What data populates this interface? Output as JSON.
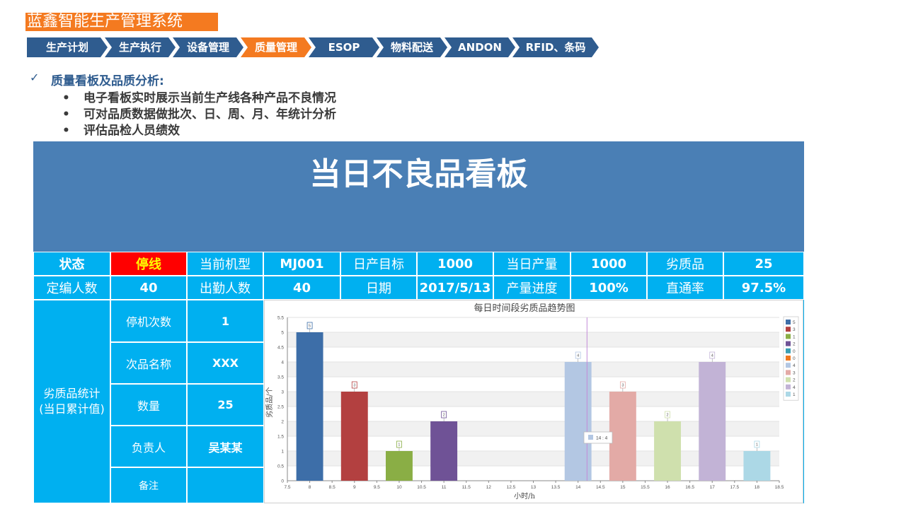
{
  "header": {
    "title": "蓝鑫智能生产管理系统"
  },
  "nav": {
    "items": [
      {
        "label": "生产计划"
      },
      {
        "label": "生产执行"
      },
      {
        "label": "设备管理"
      },
      {
        "label": "质量管理"
      },
      {
        "label": "ESOP"
      },
      {
        "label": "物料配送"
      },
      {
        "label": "ANDON"
      },
      {
        "label": "RFID、条码"
      }
    ],
    "active": "质量管理"
  },
  "section": {
    "check_mark": "✓",
    "heading": "质量看板及品质分析:",
    "bullet": "•",
    "bullets": [
      "电子看板实时展示当前生产线各种产品不良情况",
      "可对品质数据做批次、日、周、月、年统计分析",
      "评估品检人员绩效"
    ]
  },
  "board": {
    "title": "当日不良品看板",
    "row1": {
      "status_label": "状态",
      "status_value": "停线",
      "model_label": "当前机型",
      "model_value": "MJ001",
      "target_label": "日产目标",
      "target_value": "1000",
      "output_label": "当日产量",
      "output_value": "1000",
      "defect_label": "劣质品",
      "defect_value": "25"
    },
    "row2": {
      "staff_label": "定编人数",
      "staff_value": "40",
      "attend_label": "出勤人数",
      "attend_value": "40",
      "date_label": "日期",
      "date_value": "2017/5/13",
      "progress_label": "产量进度",
      "progress_value": "100%",
      "pass_label": "直通率",
      "pass_value": "97.5%"
    },
    "stats": {
      "label_line1": "劣质品统计",
      "label_line2": "(当日累计值)",
      "rows": [
        {
          "label": "停机次数",
          "value": "1"
        },
        {
          "label": "次品名称",
          "value": "XXX"
        },
        {
          "label": "数量",
          "value": "25"
        },
        {
          "label": "负责人",
          "value": "吴某某"
        },
        {
          "label": "备注",
          "value": ""
        }
      ]
    }
  },
  "chart_data": {
    "type": "bar",
    "title": "每日时间段劣质品趋势图",
    "xlabel": "小时/h",
    "ylabel": "劣质品/个",
    "xlim": [
      7.5,
      18.5
    ],
    "ylim": [
      0,
      5.5
    ],
    "x_ticks": [
      7.5,
      8,
      8.5,
      9,
      9.5,
      10,
      10.5,
      11,
      11.5,
      12,
      12.5,
      13,
      13.5,
      14,
      14.5,
      15,
      15.5,
      16,
      16.5,
      17,
      17.5,
      18,
      18.5
    ],
    "y_ticks": [
      0,
      0.5,
      1,
      1.5,
      2,
      2.5,
      3,
      3.5,
      4,
      4.5,
      5,
      5.5
    ],
    "bars": [
      {
        "x": 8,
        "value": 5,
        "color": "#3d6ea8"
      },
      {
        "x": 9,
        "value": 3,
        "color": "#b34040"
      },
      {
        "x": 10,
        "value": 1,
        "color": "#8aae45"
      },
      {
        "x": 11,
        "value": 2,
        "color": "#6f5296"
      },
      {
        "x": 14,
        "value": 4,
        "color": "#b3c7e3"
      },
      {
        "x": 15,
        "value": 3,
        "color": "#e3aaa6"
      },
      {
        "x": 16,
        "value": 2,
        "color": "#cfe0ad"
      },
      {
        "x": 17,
        "value": 4,
        "color": "#c2b3d6"
      },
      {
        "x": 18,
        "value": 1,
        "color": "#acd8e6"
      }
    ],
    "legend": [
      {
        "label": "5",
        "color": "#3d6ea8"
      },
      {
        "label": "3",
        "color": "#b34040"
      },
      {
        "label": "1",
        "color": "#8aae45"
      },
      {
        "label": "2",
        "color": "#6f5296"
      },
      {
        "label": "0",
        "color": "#3a9fb4"
      },
      {
        "label": "0",
        "color": "#f07820"
      },
      {
        "label": "4",
        "color": "#b3c7e3"
      },
      {
        "label": "3",
        "color": "#e3aaa6"
      },
      {
        "label": "2",
        "color": "#cfe0ad"
      },
      {
        "label": "4",
        "color": "#c2b3d6"
      },
      {
        "label": "1",
        "color": "#acd8e6"
      }
    ],
    "legend_position": "right",
    "grid": true,
    "cursor_x": 14.2,
    "tooltip": {
      "text": "14 : 4",
      "color": "#b3c7e3"
    }
  }
}
